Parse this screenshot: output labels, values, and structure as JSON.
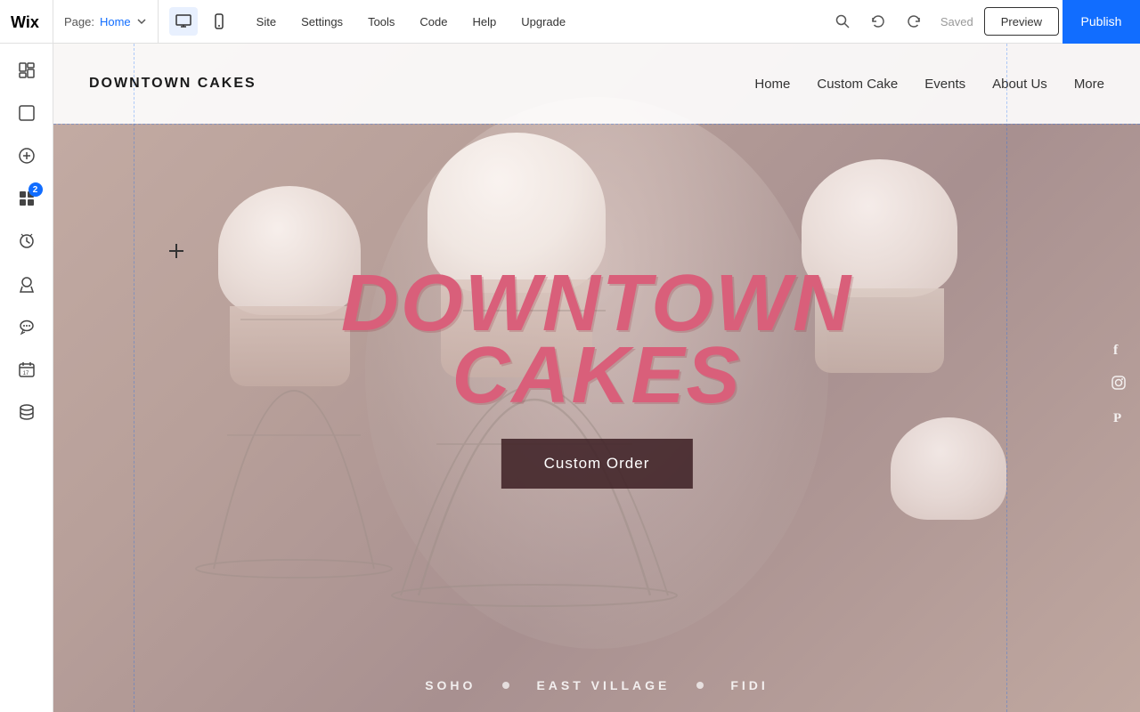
{
  "topbar": {
    "wix_logo_alt": "Wix Logo",
    "page_label": "Page:",
    "page_name": "Home",
    "views": [
      {
        "label": "Desktop",
        "icon": "desktop-icon",
        "active": true
      },
      {
        "label": "Mobile",
        "icon": "mobile-icon",
        "active": false
      }
    ],
    "nav_items": [
      {
        "label": "Site",
        "key": "site"
      },
      {
        "label": "Settings",
        "key": "settings"
      },
      {
        "label": "Tools",
        "key": "tools"
      },
      {
        "label": "Code",
        "key": "code"
      },
      {
        "label": "Help",
        "key": "help"
      },
      {
        "label": "Upgrade",
        "key": "upgrade"
      }
    ],
    "saved_label": "Saved",
    "preview_label": "Preview",
    "publish_label": "Publish"
  },
  "sidebar": {
    "icons": [
      {
        "name": "pages-icon",
        "symbol": "☰",
        "badge": null
      },
      {
        "name": "elements-icon",
        "symbol": "⬜",
        "badge": null
      },
      {
        "name": "add-icon",
        "symbol": "+",
        "badge": null
      },
      {
        "name": "apps-icon",
        "symbol": "⊞",
        "badge": "2"
      },
      {
        "name": "media-icon",
        "symbol": "↑",
        "badge": null
      },
      {
        "name": "blog-icon",
        "symbol": "✏",
        "badge": null
      },
      {
        "name": "chat-icon",
        "symbol": "◉",
        "badge": null
      },
      {
        "name": "calendar-icon",
        "symbol": "📅",
        "badge": null
      },
      {
        "name": "database-icon",
        "symbol": "≡",
        "badge": null
      }
    ]
  },
  "site_header": {
    "logo": "DOWNTOWN CAKES",
    "nav_items": [
      {
        "label": "Home"
      },
      {
        "label": "Custom Cake"
      },
      {
        "label": "Events"
      },
      {
        "label": "About Us"
      },
      {
        "label": "More"
      }
    ]
  },
  "hero": {
    "title_line1": "DOWNTOWN",
    "title_line2": "CAKES",
    "cta_label": "Custom Order"
  },
  "locations": {
    "items": [
      "SOHO",
      "EAST VILLAGE",
      "FIDI"
    ]
  },
  "social": {
    "icons": [
      {
        "name": "facebook-icon",
        "symbol": "f"
      },
      {
        "name": "instagram-icon",
        "symbol": "◎"
      },
      {
        "name": "pinterest-icon",
        "symbol": "P"
      }
    ]
  }
}
